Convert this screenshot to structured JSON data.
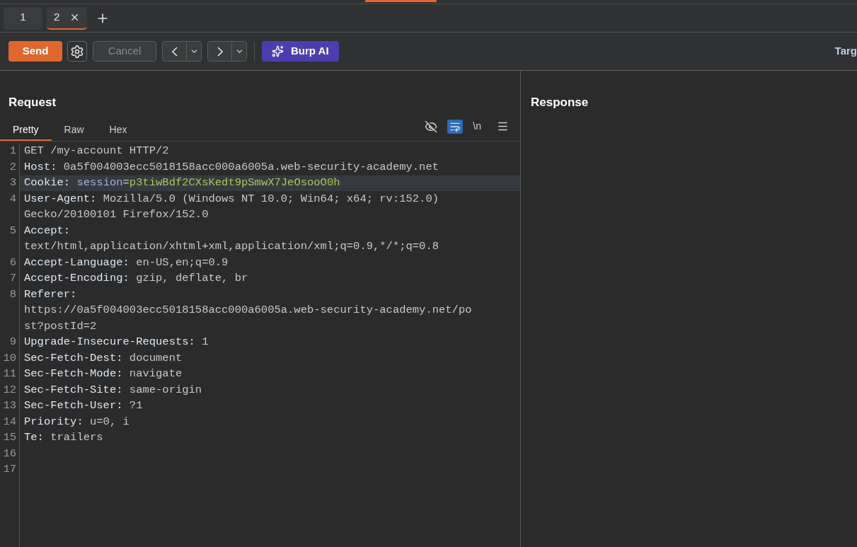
{
  "tabs": [
    {
      "label": "1",
      "selected": false,
      "closable": false
    },
    {
      "label": "2",
      "selected": true,
      "closable": true
    }
  ],
  "toolbar": {
    "send": "Send",
    "cancel": "Cancel",
    "cancel_disabled": true,
    "ai": "Burp AI",
    "target": "Targ"
  },
  "request": {
    "title": "Request",
    "view_tabs": [
      {
        "label": "Pretty",
        "selected": true
      },
      {
        "label": "Raw",
        "selected": false
      },
      {
        "label": "Hex",
        "selected": false
      }
    ],
    "newline_label": "\\n",
    "wrap_on": true,
    "lines": [
      {
        "number": "1",
        "segments": [
          {
            "kind": "text",
            "text": "GET /my-account HTTP/2"
          }
        ],
        "highlighted": false
      },
      {
        "number": "2",
        "segments": [
          {
            "kind": "name",
            "text": "Host:"
          },
          {
            "kind": "text",
            "text": " 0a5f004003ecc5018158acc000a6005a.web-security-academy.net"
          }
        ],
        "highlighted": false
      },
      {
        "number": "3",
        "segments": [
          {
            "kind": "name",
            "text": "Cookie:"
          },
          {
            "kind": "param",
            "text": " session"
          },
          {
            "kind": "text",
            "text": "="
          },
          {
            "kind": "param_value",
            "text": "p3tiwBdf2CXsKedt9pSmwX7JeOsooO0h"
          }
        ],
        "highlighted": true
      },
      {
        "number": "4",
        "segments": [
          {
            "kind": "name",
            "text": "User-Agent:"
          },
          {
            "kind": "text",
            "text": " Mozilla/5.0 (Windows NT 10.0; Win64; x64; rv:152.0)"
          }
        ],
        "continuation": [
          "Gecko/20100101 Firefox/152.0"
        ],
        "highlighted": false
      },
      {
        "number": "5",
        "segments": [
          {
            "kind": "name",
            "text": "Accept:"
          }
        ],
        "continuation": [
          "text/html,application/xhtml+xml,application/xml;q=0.9,*/*;q=0.8"
        ],
        "highlighted": false
      },
      {
        "number": "6",
        "segments": [
          {
            "kind": "name",
            "text": "Accept-Language:"
          },
          {
            "kind": "text",
            "text": " en-US,en;q=0.9"
          }
        ],
        "highlighted": false
      },
      {
        "number": "7",
        "segments": [
          {
            "kind": "name",
            "text": "Accept-Encoding:"
          },
          {
            "kind": "text",
            "text": " gzip, deflate, br"
          }
        ],
        "highlighted": false
      },
      {
        "number": "8",
        "segments": [
          {
            "kind": "name",
            "text": "Referer:"
          }
        ],
        "continuation": [
          "https://0a5f004003ecc5018158acc000a6005a.web-security-academy.net/po",
          "st?postId=2"
        ],
        "highlighted": false
      },
      {
        "number": "9",
        "segments": [
          {
            "kind": "name",
            "text": "Upgrade-Insecure-Requests:"
          },
          {
            "kind": "text",
            "text": " 1"
          }
        ],
        "highlighted": false
      },
      {
        "number": "10",
        "segments": [
          {
            "kind": "name",
            "text": "Sec-Fetch-Dest:"
          },
          {
            "kind": "text",
            "text": " document"
          }
        ],
        "highlighted": false
      },
      {
        "number": "11",
        "segments": [
          {
            "kind": "name",
            "text": "Sec-Fetch-Mode:"
          },
          {
            "kind": "text",
            "text": " navigate"
          }
        ],
        "highlighted": false
      },
      {
        "number": "12",
        "segments": [
          {
            "kind": "name",
            "text": "Sec-Fetch-Site:"
          },
          {
            "kind": "text",
            "text": " same-origin"
          }
        ],
        "highlighted": false
      },
      {
        "number": "13",
        "segments": [
          {
            "kind": "name",
            "text": "Sec-Fetch-User:"
          },
          {
            "kind": "text",
            "text": " ?1"
          }
        ],
        "highlighted": false
      },
      {
        "number": "14",
        "segments": [
          {
            "kind": "name",
            "text": "Priority:"
          },
          {
            "kind": "text",
            "text": " u=0, i"
          }
        ],
        "highlighted": false
      },
      {
        "number": "15",
        "segments": [
          {
            "kind": "name",
            "text": "Te:"
          },
          {
            "kind": "text",
            "text": " trailers"
          }
        ],
        "highlighted": false
      },
      {
        "number": "16",
        "highlighted": false
      },
      {
        "number": "17",
        "highlighted": false
      }
    ]
  },
  "response": {
    "title": "Response"
  }
}
